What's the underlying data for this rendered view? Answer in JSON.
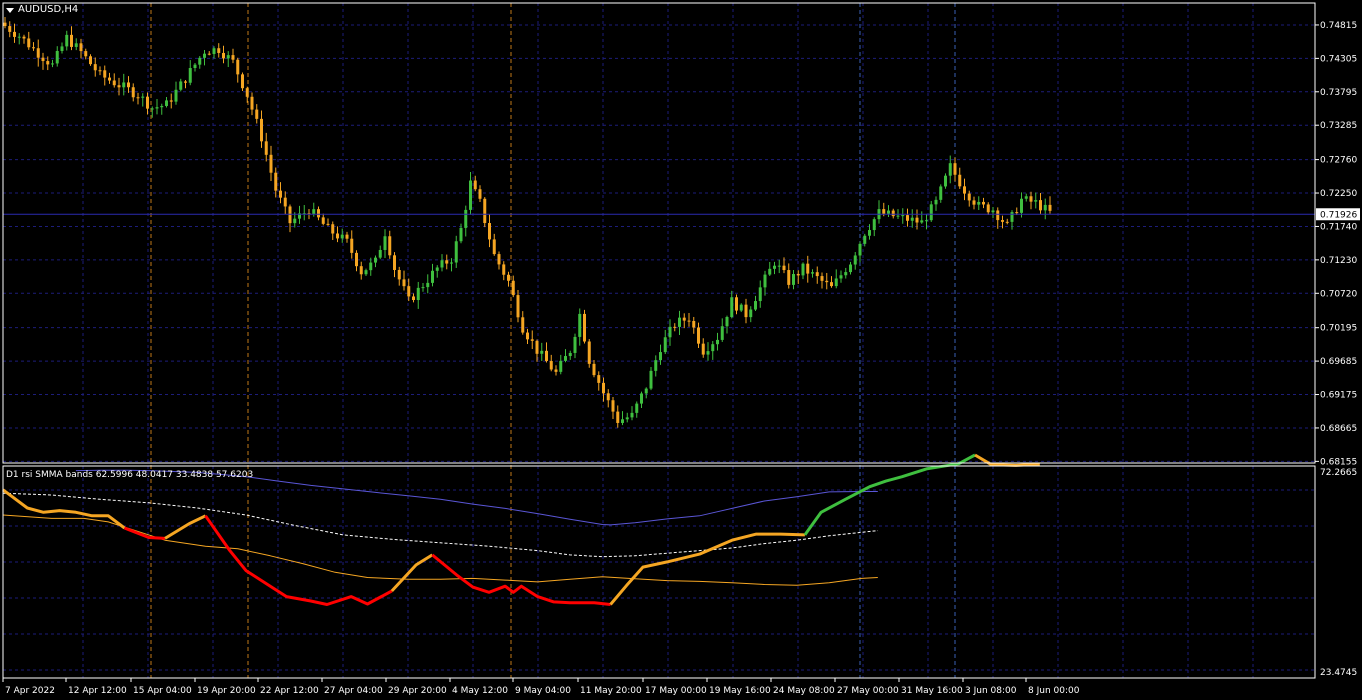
{
  "chart_data": [
    {
      "type": "candlestick",
      "title": "AUDUSD,H4",
      "price_levels": [
        "0.74815",
        "0.74305",
        "0.73795",
        "0.73285",
        "0.72760",
        "0.72250",
        "0.71740",
        "0.71230",
        "0.70720",
        "0.70195",
        "0.69685",
        "0.69175",
        "0.68665",
        "0.68155"
      ],
      "current_price": "0.71926",
      "ylim": [
        0.6813,
        0.7515
      ],
      "bull_color": "#3fbf3f",
      "bear_color": "#f5a623",
      "close_path": [
        [
          0,
          0.748
        ],
        [
          3,
          0.7465
        ],
        [
          6,
          0.7445
        ],
        [
          10,
          0.742
        ],
        [
          13,
          0.7462
        ],
        [
          16,
          0.744
        ],
        [
          20,
          0.7405
        ],
        [
          24,
          0.739
        ],
        [
          28,
          0.7375
        ],
        [
          31,
          0.7355
        ],
        [
          34,
          0.736
        ],
        [
          38,
          0.74
        ],
        [
          42,
          0.7442
        ],
        [
          45,
          0.7445
        ],
        [
          48,
          0.7425
        ],
        [
          51,
          0.7375
        ],
        [
          54,
          0.731
        ],
        [
          57,
          0.723
        ],
        [
          60,
          0.718
        ],
        [
          64,
          0.72
        ],
        [
          68,
          0.717
        ],
        [
          72,
          0.715
        ],
        [
          75,
          0.7105
        ],
        [
          78,
          0.712
        ],
        [
          80,
          0.7165
        ],
        [
          82,
          0.711
        ],
        [
          85,
          0.706
        ],
        [
          88,
          0.7085
        ],
        [
          91,
          0.711
        ],
        [
          94,
          0.7125
        ],
        [
          96,
          0.717
        ],
        [
          98,
          0.724
        ],
        [
          100,
          0.721
        ],
        [
          103,
          0.713
        ],
        [
          106,
          0.709
        ],
        [
          109,
          0.702
        ],
        [
          112,
          0.6985
        ],
        [
          116,
          0.695
        ],
        [
          119,
          0.6985
        ],
        [
          121,
          0.704
        ],
        [
          123,
          0.697
        ],
        [
          126,
          0.692
        ],
        [
          129,
          0.6878
        ],
        [
          132,
          0.6885
        ],
        [
          135,
          0.693
        ],
        [
          138,
          0.699
        ],
        [
          141,
          0.7025
        ],
        [
          144,
          0.7035
        ],
        [
          147,
          0.6985
        ],
        [
          150,
          0.7005
        ],
        [
          153,
          0.706
        ],
        [
          156,
          0.704
        ],
        [
          159,
          0.708
        ],
        [
          162,
          0.712
        ],
        [
          165,
          0.709
        ],
        [
          168,
          0.711
        ],
        [
          171,
          0.7095
        ],
        [
          174,
          0.708
        ],
        [
          178,
          0.712
        ],
        [
          181,
          0.7165
        ],
        [
          184,
          0.7195
        ],
        [
          187,
          0.719
        ],
        [
          190,
          0.7185
        ],
        [
          193,
          0.718
        ],
        [
          196,
          0.721
        ],
        [
          199,
          0.7265
        ],
        [
          202,
          0.723
        ],
        [
          205,
          0.7205
        ],
        [
          208,
          0.72
        ],
        [
          211,
          0.7175
        ],
        [
          214,
          0.7215
        ],
        [
          217,
          0.721
        ],
        [
          220,
          0.7195
        ]
      ]
    },
    {
      "type": "line",
      "title": "D1 rsi SMMA bands 62.5996 48.0417 33.4838 57.6203",
      "ylim": [
        23.4745,
        72.2665
      ],
      "ymax_label": "72.2665",
      "ymin_label": "23.4745",
      "series": [
        {
          "color": "#5a56d6",
          "values": [
            [
              9,
              71.2
            ],
            [
              12,
              71.3
            ],
            [
              15,
              71.3
            ],
            [
              18,
              71.2
            ],
            [
              21,
              71.0
            ],
            [
              24,
              70.8
            ],
            [
              27,
              70.3
            ],
            [
              30,
              69.8
            ],
            [
              34,
              68.8
            ],
            [
              38,
              67.8
            ],
            [
              42,
              67.0
            ],
            [
              46,
              66.2
            ],
            [
              50,
              65.4
            ],
            [
              54,
              64.6
            ],
            [
              58,
              63.5
            ],
            [
              62,
              62.5
            ],
            [
              66,
              61.3
            ],
            [
              70,
              60.0
            ],
            [
              74,
              58.8
            ],
            [
              75,
              58.7
            ],
            [
              78,
              59.2
            ],
            [
              82,
              60.1
            ],
            [
              86,
              60.8
            ],
            [
              90,
              62.5
            ],
            [
              94,
              64.2
            ],
            [
              98,
              65.2
            ],
            [
              102,
              66.3
            ],
            [
              106,
              66.4
            ],
            [
              108,
              66.4
            ]
          ]
        },
        {
          "color": "#ffffff",
          "dashed": true,
          "values": [
            [
              0,
              66.0
            ],
            [
              6,
              65.6
            ],
            [
              12,
              64.6
            ],
            [
              18,
              63.8
            ],
            [
              24,
              62.6
            ],
            [
              30,
              61.0
            ],
            [
              36,
              58.6
            ],
            [
              42,
              56.4
            ],
            [
              48,
              55.4
            ],
            [
              54,
              54.6
            ],
            [
              60,
              53.8
            ],
            [
              66,
              52.8
            ],
            [
              70,
              51.8
            ],
            [
              74,
              51.4
            ],
            [
              78,
              51.6
            ],
            [
              82,
              52.2
            ],
            [
              86,
              52.8
            ],
            [
              90,
              53.4
            ],
            [
              94,
              54.4
            ],
            [
              98,
              55.2
            ],
            [
              102,
              56.2
            ],
            [
              106,
              57.0
            ],
            [
              108,
              57.4
            ]
          ]
        },
        {
          "color": "#f5a623",
          "values": [
            [
              0,
              61.0
            ],
            [
              6,
              60.2
            ],
            [
              10,
              60.2
            ],
            [
              13,
              59.4
            ],
            [
              16,
              57.6
            ],
            [
              20,
              55.2
            ],
            [
              25,
              53.8
            ],
            [
              29,
              53.2
            ],
            [
              33,
              51.6
            ],
            [
              37,
              49.8
            ],
            [
              41,
              47.8
            ],
            [
              45,
              46.6
            ],
            [
              50,
              46.2
            ],
            [
              54,
              46.2
            ],
            [
              58,
              46.4
            ],
            [
              62,
              46.0
            ],
            [
              66,
              45.6
            ],
            [
              70,
              46.2
            ],
            [
              74,
              46.8
            ],
            [
              78,
              46.3
            ],
            [
              82,
              45.9
            ],
            [
              86,
              45.7
            ],
            [
              90,
              45.4
            ],
            [
              94,
              45.0
            ],
            [
              98,
              44.8
            ],
            [
              102,
              45.4
            ],
            [
              106,
              46.4
            ],
            [
              108,
              46.6
            ]
          ]
        },
        {
          "color": "#f5a623",
          "width": 3,
          "values": [
            [
              0,
              66.8
            ],
            [
              3,
              62.6
            ],
            [
              5,
              61.6
            ],
            [
              7,
              62.0
            ],
            [
              9,
              61.6
            ],
            [
              11,
              60.8
            ],
            [
              13,
              60.8
            ],
            [
              15,
              58.0
            ]
          ]
        },
        {
          "color": "#ff0000",
          "width": 3,
          "values": [
            [
              15,
              58.0
            ],
            [
              18,
              55.8
            ],
            [
              20,
              55.6
            ]
          ]
        },
        {
          "color": "#f5a623",
          "width": 3,
          "values": [
            [
              20,
              55.6
            ],
            [
              23,
              59.0
            ],
            [
              25,
              60.8
            ]
          ]
        },
        {
          "color": "#ff0000",
          "width": 3,
          "values": [
            [
              25,
              60.8
            ],
            [
              28,
              52.8
            ],
            [
              30,
              48.2
            ],
            [
              33,
              44.6
            ],
            [
              35,
              42.2
            ],
            [
              38,
              41.2
            ],
            [
              40,
              40.4
            ],
            [
              43,
              42.2
            ],
            [
              45,
              40.5
            ],
            [
              48,
              43.5
            ]
          ]
        },
        {
          "color": "#f5a623",
          "width": 3,
          "values": [
            [
              48,
              43.5
            ],
            [
              51,
              49.5
            ],
            [
              53,
              51.8
            ]
          ]
        },
        {
          "color": "#ff0000",
          "width": 3,
          "values": [
            [
              53,
              51.8
            ],
            [
              56,
              47.2
            ],
            [
              58,
              44.4
            ],
            [
              60,
              43.2
            ],
            [
              62,
              44.6
            ],
            [
              63,
              43.2
            ],
            [
              64,
              44.6
            ],
            [
              66,
              42.2
            ],
            [
              68,
              41.0
            ],
            [
              70,
              40.8
            ],
            [
              73,
              40.8
            ],
            [
              75,
              40.4
            ]
          ]
        },
        {
          "color": "#f5a623",
          "width": 3,
          "values": [
            [
              75,
              40.4
            ],
            [
              77,
              44.8
            ],
            [
              79,
              49.0
            ],
            [
              82,
              50.2
            ],
            [
              86,
              52.0
            ],
            [
              90,
              55.2
            ],
            [
              93,
              56.6
            ],
            [
              96,
              56.6
            ],
            [
              99,
              56.4
            ]
          ]
        },
        {
          "color": "#3fbf3f",
          "width": 3,
          "values": [
            [
              99,
              56.4
            ],
            [
              101,
              61.6
            ],
            [
              104,
              64.6
            ],
            [
              107,
              67.5
            ],
            [
              109,
              68.8
            ],
            [
              111,
              69.8
            ],
            [
              114,
              71.6
            ],
            [
              116,
              72.2
            ],
            [
              118,
              72.8
            ],
            [
              119,
              73.8
            ],
            [
              120,
              74.8
            ]
          ]
        },
        {
          "color": "#f5a623",
          "width": 3,
          "values": [
            [
              120,
              74.8
            ],
            [
              122,
              72.6
            ],
            [
              125,
              72.4
            ],
            [
              127,
              72.6
            ],
            [
              128,
              72.6
            ]
          ]
        }
      ]
    }
  ],
  "x_axis_labels": [
    "7 Apr 2022",
    "12 Apr 12:00",
    "15 Apr 04:00",
    "19 Apr 20:00",
    "22 Apr 12:00",
    "27 Apr 04:00",
    "29 Apr 20:00",
    "4 May 12:00",
    "9 May 04:00",
    "11 May 20:00",
    "17 May 00:00",
    "19 May 16:00",
    "24 May 08:00",
    "27 May 00:00",
    "31 May 16:00",
    "3 Jun 08:00",
    "8 Jun 00:00"
  ]
}
